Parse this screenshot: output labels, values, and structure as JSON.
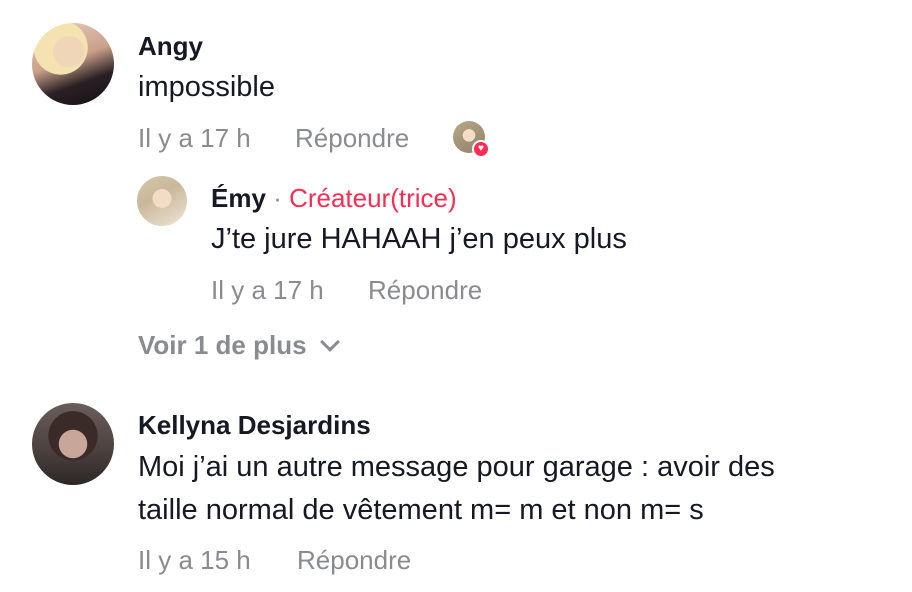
{
  "comments": [
    {
      "author": "Angy",
      "text": "impossible",
      "time": "Il y a 17 h",
      "reply_label": "Répondre",
      "replies": [
        {
          "author": "Émy",
          "separator": "·",
          "badge": "Créateur(trice)",
          "text": "J’te jure HAHAAH j’en peux plus",
          "time": "Il y a 17 h",
          "reply_label": "Répondre"
        }
      ],
      "more_label": "Voir 1 de plus"
    },
    {
      "author": "Kellyna Desjardins",
      "text_line1": "Moi j’ai un autre message pour garage : avoir des",
      "text_line2": "taille normal de vêtement m= m et non m= s",
      "time": "Il y a 15 h",
      "reply_label": "Répondre"
    }
  ],
  "colors": {
    "creator_badge": "#fe2c55",
    "meta_text": "#8a8b91",
    "primary_text": "#161823"
  },
  "icons": {
    "creator_like": "heart-icon",
    "more_chevron": "chevron-down-icon"
  }
}
